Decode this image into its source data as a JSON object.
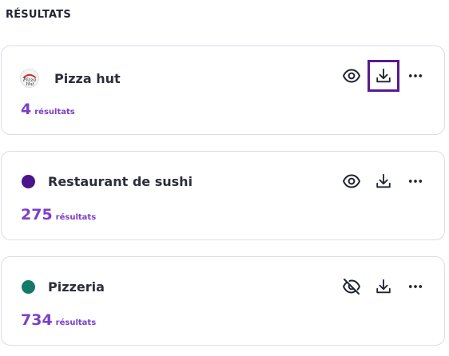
{
  "section": {
    "title": "RÉSULTATS"
  },
  "results": [
    {
      "name": "Pizza hut",
      "count": "4",
      "count_label": "résultats",
      "marker": "pizza-hut-logo",
      "color": "#d62828",
      "visibility": "visible",
      "download_focused": true
    },
    {
      "name": "Restaurant de sushi",
      "count": "275",
      "count_label": "résultats",
      "marker": "dot",
      "color": "#4a148c",
      "visibility": "visible",
      "download_focused": false
    },
    {
      "name": "Pizzeria",
      "count": "734",
      "count_label": "résultats",
      "marker": "dot",
      "color": "#137a6b",
      "visibility": "hidden",
      "download_focused": false
    }
  ],
  "icons": {
    "eye": "eye-icon",
    "eye_off": "eye-off-icon",
    "download": "download-icon",
    "more": "more-horizontal-icon"
  },
  "colors": {
    "accent": "#7b3fc9",
    "focus_ring": "#5b1a8b",
    "card_border": "#d9dde6"
  }
}
